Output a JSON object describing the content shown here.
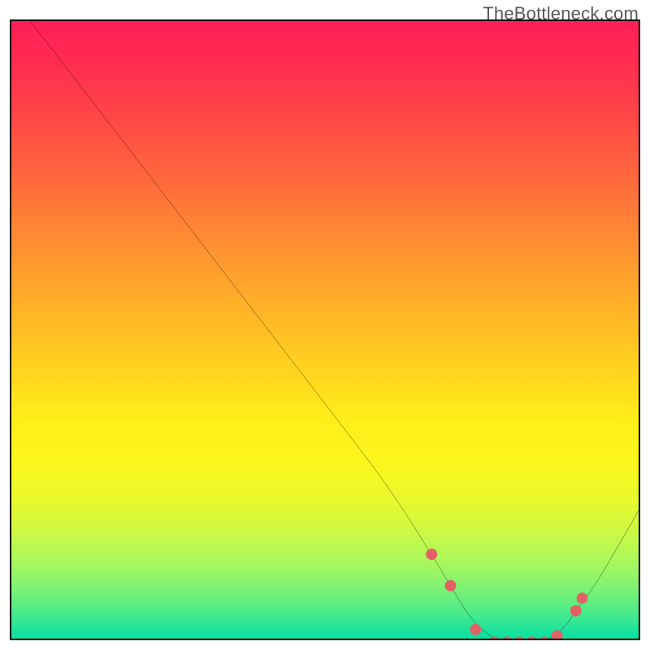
{
  "watermark": "TheBottleneck.com",
  "chart_data": {
    "type": "line",
    "title": "",
    "xlabel": "",
    "ylabel": "",
    "xlim": [
      0,
      100
    ],
    "ylim": [
      0,
      100
    ],
    "series": [
      {
        "name": "curve",
        "x": [
          3,
          10,
          20,
          30,
          40,
          50,
          60,
          67,
          70,
          73,
          76,
          79,
          82,
          85,
          88,
          90,
          93,
          96,
          100
        ],
        "values": [
          100,
          91,
          78,
          65,
          52,
          39,
          26,
          15,
          10,
          5,
          2,
          1,
          1,
          1,
          3,
          6,
          10,
          15,
          22
        ]
      }
    ],
    "markers": {
      "name": "highlight-dots",
      "color": "#e06265",
      "x": [
        67,
        70,
        74,
        77,
        79,
        81,
        83,
        85,
        87,
        90,
        91
      ],
      "values": [
        15,
        10,
        3,
        1,
        1,
        1,
        1,
        1,
        2,
        6,
        8
      ]
    },
    "background_gradient_stops": [
      {
        "pos": 0.0,
        "color": "#ff1f56"
      },
      {
        "pos": 0.14,
        "color": "#ff4247"
      },
      {
        "pos": 0.36,
        "color": "#ff8f32"
      },
      {
        "pos": 0.56,
        "color": "#ffd21f"
      },
      {
        "pos": 0.72,
        "color": "#fbf71d"
      },
      {
        "pos": 0.88,
        "color": "#a6f75e"
      },
      {
        "pos": 1.0,
        "color": "#0fe0a2"
      }
    ]
  }
}
